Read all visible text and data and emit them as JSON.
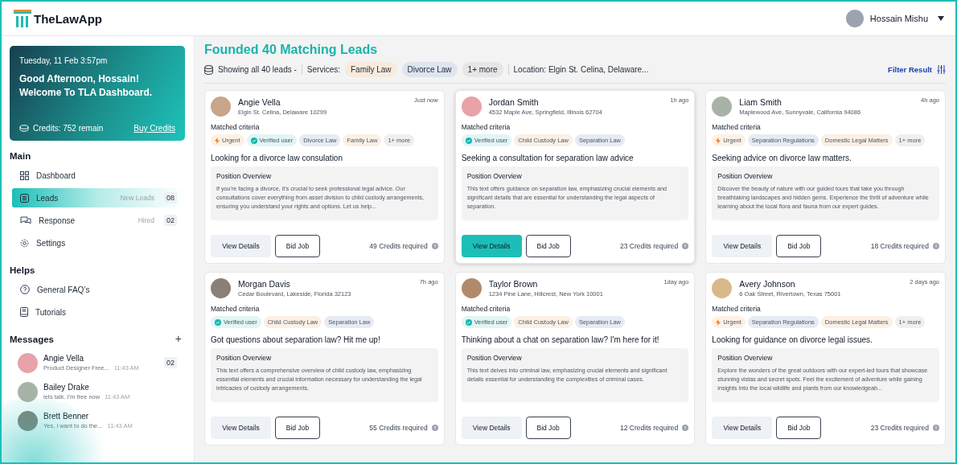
{
  "header": {
    "logo": "TheLawApp",
    "user": "Hossain Mishu"
  },
  "sidebar": {
    "welcome": {
      "date": "Tuesday, 11 Feb 3:57pm",
      "greeting": "Good Afternoon, Hossain!",
      "subtitle": "Welcome To TLA Dashboard.",
      "credits": "Credits: 752 remain",
      "buy": "Buy Credits"
    },
    "sections": [
      {
        "title": "Main",
        "items": [
          {
            "label": "Dashboard",
            "selected": false
          },
          {
            "label": "Leads",
            "selected": true,
            "badge_label": "New Leads",
            "badge": "08"
          },
          {
            "label": "Response",
            "selected": false,
            "badge_label": "Hired",
            "badge": "02"
          },
          {
            "label": "Settings",
            "selected": false
          }
        ]
      },
      {
        "title": "Helps",
        "items": [
          {
            "label": "General FAQ’s",
            "selected": false
          },
          {
            "label": "Tutorials",
            "selected": false
          }
        ]
      }
    ],
    "messages": {
      "title": "Messages",
      "add": "+",
      "items": [
        {
          "name": "Angie Vella",
          "preview": "Product Designer Free...",
          "time": "11:43 AM",
          "count": "02"
        },
        {
          "name": "Bailey Drake",
          "preview": "lets talk. I'm free now",
          "time": "11:43 AM"
        },
        {
          "name": "Brett Benner",
          "preview": "Yes, i want to do the...",
          "time": "11:43 AM"
        }
      ]
    }
  },
  "main": {
    "title": "Founded 40 Matching Leads",
    "showing": "Showing all 40 leads -",
    "services_label": "Services:",
    "services": [
      {
        "label": "Family Law",
        "color": "#f8ebdd"
      },
      {
        "label": "Divorce Law",
        "color": "#dfe5ee"
      },
      {
        "label": "1+ more",
        "color": "#e6e6e6"
      }
    ],
    "location": "Location: Elgin St. Celina, Delaware...",
    "filter": "Filter Result",
    "cards": [
      {
        "name": "Angie Vella",
        "address": "Elgin St. Celina, Delaware 10299",
        "time": "Just now",
        "selected": false,
        "criteria_label": "Matched criteria",
        "tags": [
          {
            "kind": "urgent",
            "label": "Urgent",
            "color": "#fdf1e6"
          },
          {
            "kind": "verified",
            "label": "Verified user",
            "color": "#e1f5f5"
          },
          {
            "kind": "plain",
            "label": "Divorce Law",
            "color": "#e6ebf3"
          },
          {
            "kind": "plain",
            "label": "Family Law",
            "color": "#fcefe3"
          },
          {
            "kind": "plain",
            "label": "1+ more",
            "color": "#efefef"
          }
        ],
        "heading": "Looking for a divorce law consulation",
        "overview_title": "Position Overview",
        "overview": "If you're facing a divorce, it's crucial to seek professional legal advice. Our consultations cover everything from asset division to child custody arrangements, ensuring you understand your rights and options. Let us help...",
        "view": "View Details",
        "bid": "Bid Job",
        "credits": "49 Credits required"
      },
      {
        "name": "Jordan Smith",
        "address": "4532 Maple Ave, Springfield, Illinois 62704",
        "time": "1h ago",
        "selected": true,
        "criteria_label": "Matched criteria",
        "tags": [
          {
            "kind": "verified",
            "label": "Verified user",
            "color": "#e1f5f5"
          },
          {
            "kind": "plain",
            "label": "Child Custody Law",
            "color": "#fcefe3"
          },
          {
            "kind": "plain",
            "label": "Separation Law",
            "color": "#e6ebf3"
          }
        ],
        "heading": "Seeking a consultation for separation law advice",
        "overview_title": "Position Overview",
        "overview": "This text offers guidance on separation law, emphasizing crucial elements and significant details that are essential for understanding the legal aspects of separation.",
        "view": "View Details",
        "bid": "Bid Job",
        "credits": "23 Credits required"
      },
      {
        "name": "Liam Smith",
        "address": "Maplewood Ave, Sunnyvale, California 94086",
        "time": "4h ago",
        "selected": false,
        "criteria_label": "Matched criteria",
        "tags": [
          {
            "kind": "urgent",
            "label": "Urgent",
            "color": "#fdf1e6"
          },
          {
            "kind": "plain",
            "label": "Separation Regulations",
            "color": "#e6ebf3"
          },
          {
            "kind": "plain",
            "label": "Domestic Legal Matters",
            "color": "#fcefe3"
          },
          {
            "kind": "plain",
            "label": "1+ more",
            "color": "#efefef"
          }
        ],
        "heading": "Seeking advice on divorce law matters.",
        "overview_title": "Position Overview",
        "overview": "Discover the beauty of nature with our guided tours that take you through breathtaking landscapes and hidden gems. Experience the thrill of adventure while learning about the local flora and fauna from our expert guides.",
        "view": "View Details",
        "bid": "Bid Job",
        "credits": "18 Credits required"
      },
      {
        "name": "Morgan Davis",
        "address": "Cedar Boulevard, Lakeside, Florida 32123",
        "time": "7h ago",
        "selected": false,
        "criteria_label": "Matched criteria",
        "tags": [
          {
            "kind": "verified",
            "label": "Verified user",
            "color": "#e1f5f5"
          },
          {
            "kind": "plain",
            "label": "Child Custody Law",
            "color": "#fcefe3"
          },
          {
            "kind": "plain",
            "label": "Separation Law",
            "color": "#e6ebf3"
          }
        ],
        "heading": "Got questions about separation law? Hit me up!",
        "overview_title": "Position Overview",
        "overview": "This text offers a comprehensive overview of child custody law, emphasizing essential elements and crucial information necessary for understanding the legal intricacies of custody arrangements.",
        "view": "View Details",
        "bid": "Bid Job",
        "credits": "55 Credits required"
      },
      {
        "name": "Taylor Brown",
        "address": "1234 Pine Lane, Hillcrest, New York 10001",
        "time": "1day ago",
        "selected": false,
        "criteria_label": "Matched criteria",
        "tags": [
          {
            "kind": "verified",
            "label": "Verified user",
            "color": "#e1f5f5"
          },
          {
            "kind": "plain",
            "label": "Child Custody Law",
            "color": "#fcefe3"
          },
          {
            "kind": "plain",
            "label": "Separation Law",
            "color": "#e6ebf3"
          }
        ],
        "heading": "Thinking about a chat on separation law? I'm here for it!",
        "overview_title": "Position Overview",
        "overview": "This text delves into criminal law, emphasizing crucial elements and significant details essential for understanding the complexities of criminal cases.",
        "view": "View Details",
        "bid": "Bid Job",
        "credits": "12 Credits required"
      },
      {
        "name": "Avery Johnson",
        "address": "6 Oak Street, Rivertown, Texas 75001",
        "time": "2 days ago",
        "selected": false,
        "criteria_label": "Matched criteria",
        "tags": [
          {
            "kind": "urgent",
            "label": "Urgent",
            "color": "#fdf1e6"
          },
          {
            "kind": "plain",
            "label": "Separation Regulations",
            "color": "#e6ebf3"
          },
          {
            "kind": "plain",
            "label": "Domestic Legal Matters",
            "color": "#fcefe3"
          },
          {
            "kind": "plain",
            "label": "1+ more",
            "color": "#efefef"
          }
        ],
        "heading": "Looking for guidance on divorce legal issues.",
        "overview_title": "Position Overview",
        "overview": "Explore the wonders of the great outdoors with our expert-led tours that showcase stunning vistas and secret spots. Feel the excitement of adventure while gaining insights into the local wildlife and plants from our knowledgeab...",
        "view": "View Details",
        "bid": "Bid Job",
        "credits": "23 Credits required"
      }
    ]
  }
}
